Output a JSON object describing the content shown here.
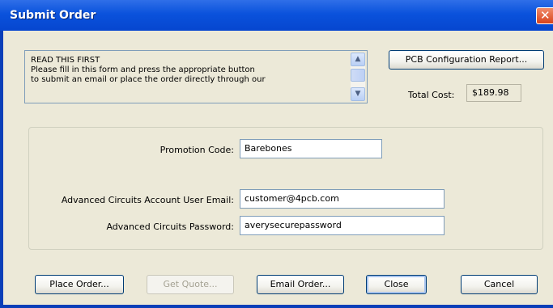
{
  "window": {
    "title": "Submit Order",
    "close_symbol": "✕"
  },
  "info": {
    "lines": [
      "READ THIS FIRST",
      "Please fill in this form and press the appropriate button",
      "to submit an email or place the order directly through our"
    ],
    "scroll_up": "▲",
    "scroll_down": "▼"
  },
  "pcb_button": "PCB Configuration Report...",
  "total": {
    "label": "Total Cost:",
    "value": "$189.98"
  },
  "form": {
    "promo_label": "Promotion Code:",
    "promo_value": "Barebones",
    "email_label": "Advanced Circuits Account User Email:",
    "email_value": "customer@4pcb.com",
    "password_label": "Advanced Circuits Password:",
    "password_value": "averysecurepassword"
  },
  "buttons": {
    "place_order": "Place Order...",
    "get_quote": "Get Quote...",
    "email_order": "Email Order...",
    "close": "Close",
    "cancel": "Cancel"
  }
}
